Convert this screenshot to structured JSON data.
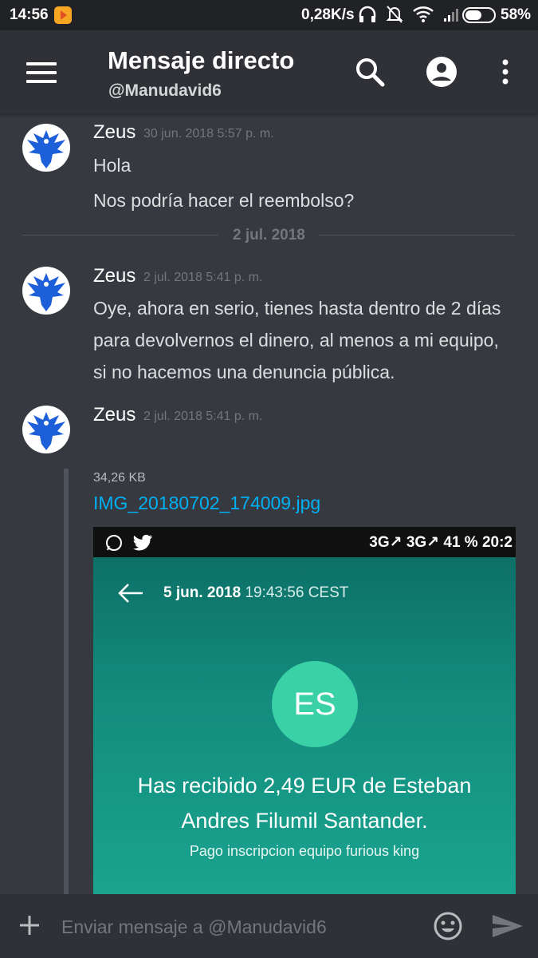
{
  "status_bar": {
    "time": "14:56",
    "network_speed": "0,28K/s",
    "battery": "58%",
    "battery_level": 0.58
  },
  "header": {
    "title": "Mensaje directo",
    "subtitle": "@Manudavid6"
  },
  "messages": [
    {
      "author": "Zeus",
      "timestamp": "30 jun. 2018 5:57 p. m.",
      "lines": [
        "Hola",
        "Nos podría hacer el reembolso?"
      ]
    },
    {
      "author": "Zeus",
      "timestamp": "2 jul. 2018 5:41 p. m.",
      "lines": [
        "Oye, ahora en serio, tienes hasta dentro de 2 días",
        "para devolvernos el dinero, al menos a mi equipo,",
        "si no hacemos una denuncia pública."
      ]
    },
    {
      "author": "Zeus",
      "timestamp": "2 jul. 2018 5:41 p. m.",
      "attachment": {
        "size": "34,26 KB",
        "filename": "IMG_20180702_174009.jpg"
      }
    }
  ],
  "date_divider": "2 jul. 2018",
  "screenshot_preview": {
    "status_right": "3G↗ 3G↗ 41 % 20:2",
    "date": "5 jun. 2018",
    "time": "19:43:56 CEST",
    "initials": "ES",
    "received_line1": "Has recibido 2,49 EUR de Esteban",
    "received_line2": "Andres Filumil Santander.",
    "concept": "Pago inscripcion equipo furious king"
  },
  "composer": {
    "placeholder": "Enviar mensaje a @Manudavid6"
  },
  "colors": {
    "background": "#36393f",
    "header": "#2f3136",
    "link": "#00b0f4",
    "avatar_blue": "#1d5fd8"
  },
  "icons": [
    "menu-icon",
    "search-icon",
    "account-icon",
    "more-vert-icon",
    "plus-icon",
    "emoji-icon",
    "send-icon",
    "phoenix-avatar"
  ]
}
